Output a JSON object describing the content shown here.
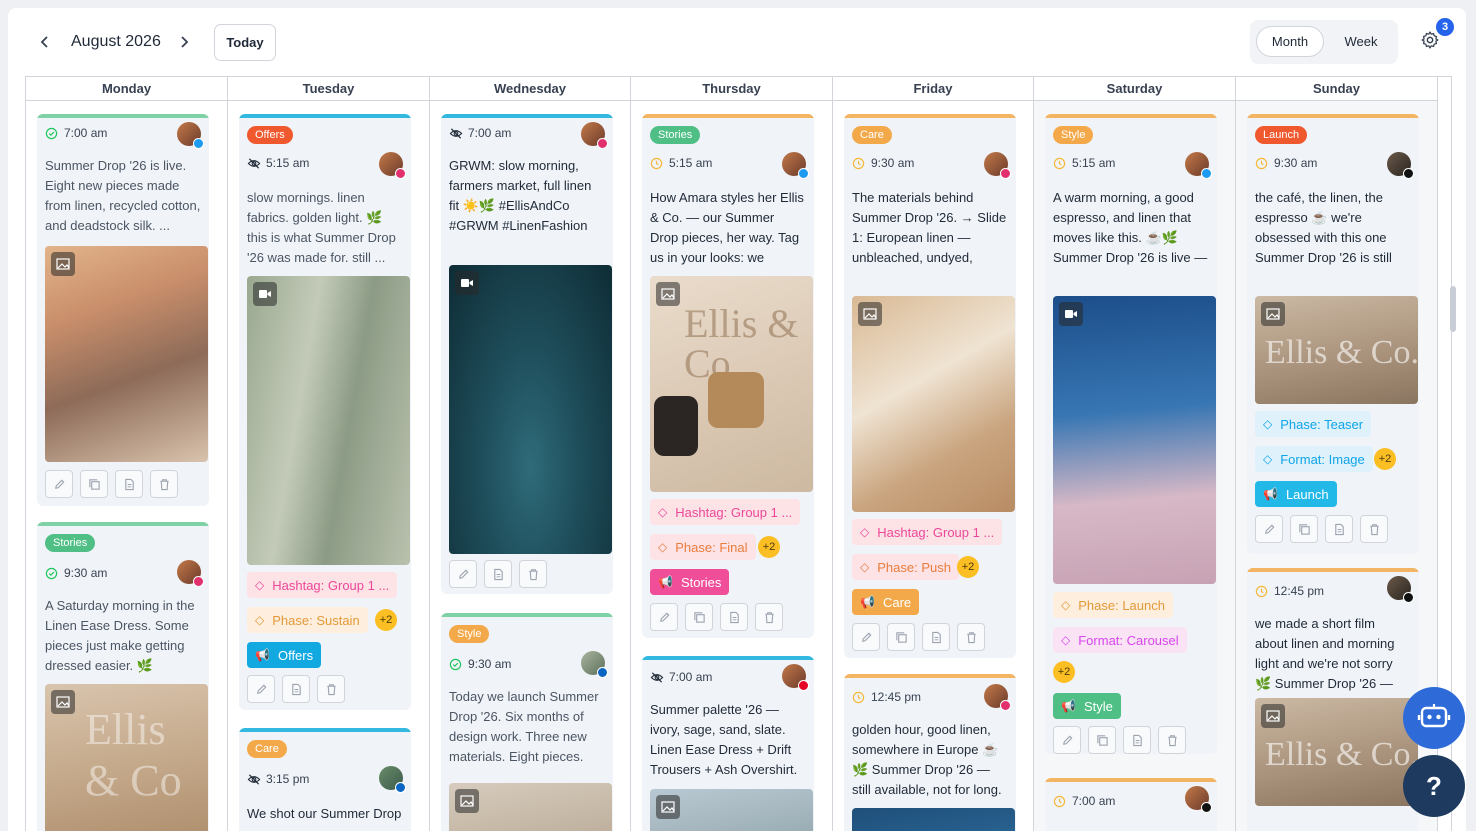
{
  "toolbar": {
    "month_label": "August 2026",
    "today_label": "Today",
    "views": [
      "Month",
      "Week"
    ],
    "active_view": "Month",
    "notification_count": "3"
  },
  "days": [
    "Monday",
    "Tuesday",
    "Wednesday",
    "Thursday",
    "Friday",
    "Saturday",
    "Sunday"
  ],
  "colors": {
    "stories": "#4caf7a",
    "offers": "#f0582e",
    "care": "#f3a94a",
    "style": "#f3a94a",
    "launch": "#f0582e",
    "tag_pink": "#ec4899",
    "tag_blue": "#0ea5e9",
    "tag_orange": "#ea7d3c"
  },
  "cards": {
    "mon1": {
      "time": "7:00 am",
      "text": "Summer Drop '26 is live. Eight new pieces made from linen, recycled cotton, and deadstock silk. ..."
    },
    "mon2": {
      "badge": "Stories",
      "time": "9:30 am",
      "text": "A Saturday morning in the Linen Ease Dress. Some pieces just make getting dressed easier. 🌿 #EllisA..."
    },
    "tue1": {
      "badge": "Offers",
      "time": "5:15 am",
      "text": "slow mornings. linen fabrics. golden light. 🌿 this is what Summer Drop '26 was made for. still ...",
      "tags": [
        "Hashtag: Group 1 ...",
        "Phase: Sustain",
        "Offers"
      ],
      "plus": "+2"
    },
    "tue2": {
      "badge": "Care",
      "time": "3:15 pm",
      "text": "We shot our Summer Drop"
    },
    "wed1": {
      "time": "7:00 am",
      "text": "GRWM: slow morning, farmers market, full linen fit ☀️🌿 #EllisAndCo #GRWM #LinenFashion #SummerMorni..."
    },
    "wed2": {
      "badge": "Style",
      "time": "9:30 am",
      "text": "Today we launch Summer Drop '26. Six months of design work. Three new materials. Eight pieces. Every ..."
    },
    "thu1": {
      "badge": "Stories",
      "time": "5:15 am",
      "text": "How Amara styles her Ellis & Co. — our Summer Drop pieces, her way. Tag us in your looks: we feature a ...",
      "tags": [
        "Hashtag: Group 1 ...",
        "Phase: Final",
        "Stories"
      ],
      "plus": "+2",
      "image_text": "Ellis & Co."
    },
    "thu2": {
      "time": "7:00 am",
      "text": "Summer palette '26 — ivory, sage, sand, slate. Linen Ease Dress + Drift Trousers + Ash Overshirt. ..."
    },
    "fri1": {
      "badge": "Care",
      "time": "9:30 am",
      "text": "The materials behind Summer Drop '26. → Slide 1: European linen — unbleached, undyed, 100% ...",
      "tags": [
        "Hashtag: Group 1 ...",
        "Phase: Push",
        "Care"
      ],
      "plus": "+2"
    },
    "fri2": {
      "time": "12:45 pm",
      "text": "golden hour, good linen, somewhere in Europe ☕ 🌿 Summer Drop '26 — still available, not for long."
    },
    "sat1": {
      "badge": "Style",
      "time": "5:15 am",
      "text": "A warm morning, a good espresso, and linen that moves like this. ☕🌿 Summer Drop '26 is live — ...",
      "tags": [
        "Phase: Launch",
        "Format: Carousel",
        "Style"
      ],
      "plus": "+2"
    },
    "sat2": {
      "time": "7:00 am"
    },
    "sun1": {
      "badge": "Launch",
      "time": "9:30 am",
      "text": "the café, the linen, the espresso ☕ we're obsessed with this one Summer Drop '26 is still live — ...",
      "tags": [
        "Phase: Teaser",
        "Format: Image",
        "Launch"
      ],
      "plus": "+2",
      "image_text": "Ellis & Co."
    },
    "sun2": {
      "time": "12:45 pm",
      "text": "we made a short film about linen and morning light and we're not sorry 🌿 Summer Drop '26 — the ...",
      "image_text": "Ellis & Co."
    },
    "mon2_image_text": "Ellis & Co"
  },
  "icons": [
    "chevron-left-icon",
    "chevron-right-icon",
    "gear-icon",
    "clock-icon",
    "eye-off-icon",
    "check-circle-icon",
    "image-icon",
    "video-icon",
    "tag-icon",
    "megaphone-icon",
    "edit-icon",
    "copy-icon",
    "document-icon",
    "trash-icon",
    "robot-icon",
    "help-icon"
  ]
}
